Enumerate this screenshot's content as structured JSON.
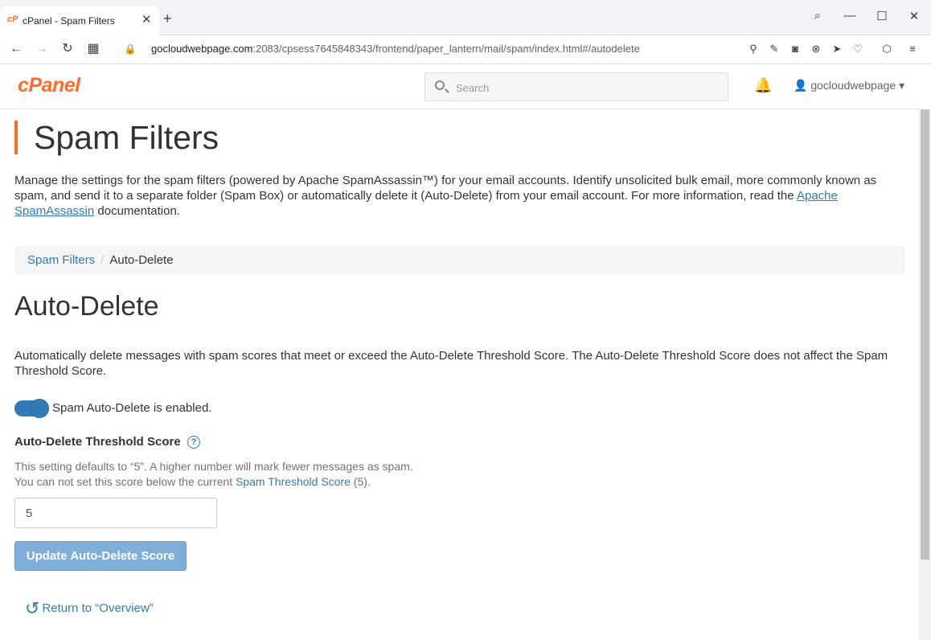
{
  "browser": {
    "tab_favicon": "cP",
    "tab_title": "cPanel - Spam Filters",
    "tab_close": "✕",
    "new_tab": "+",
    "url_host": "gocloudwebpage.com",
    "url_rest": ":2083/cpsess7645848343/frontend/paper_lantern/mail/spam/index.html#/autodelete",
    "window_controls": {
      "search": "⌕",
      "minimize": "—",
      "maximize": "☐",
      "close": "✕"
    },
    "nav": {
      "back": "←",
      "forward": "→",
      "reload": "↻",
      "apps": "▦",
      "lock": "🔒"
    },
    "extension_icons": [
      "zoom-icon",
      "edit-icon",
      "camera-icon",
      "block-icon",
      "send-icon",
      "heart-icon",
      "box-icon",
      "menu-icon"
    ]
  },
  "header": {
    "logo": "cPanel",
    "search_placeholder": "Search",
    "bell": "🔔",
    "user": "👤 gocloudwebpage ▾"
  },
  "page": {
    "title": "Spam Filters",
    "intro_before_link": "Manage the settings for the spam filters (powered by Apache SpamAssassin™) for your email accounts. Identify unsolicited bulk email, more commonly known as spam, and send it to a separate folder (Spam Box) or automatically delete it (Auto-Delete) from your email account. For more information, read the ",
    "intro_link": "Apache SpamAssassin",
    "intro_after_link": " documentation."
  },
  "breadcrumb": {
    "parent": "Spam Filters",
    "separator": "/",
    "current": "Auto-Delete"
  },
  "autodelete": {
    "title": "Auto-Delete",
    "description": "Automatically delete messages with spam scores that meet or exceed the Auto-Delete Threshold Score. The Auto-Delete Threshold Score does not affect the Spam Threshold Score.",
    "toggle_label": "Spam Auto-Delete is enabled.",
    "toggle_enabled": true,
    "field_label": "Auto-Delete Threshold Score",
    "help": "?",
    "hint_line1": "This setting defaults to “5”. A higher number will mark fewer messages as spam.",
    "hint_line2_before": "You can not set this score below the current ",
    "hint_line2_link": "Spam Threshold Score",
    "hint_line2_after": " (5).",
    "score_value": "5",
    "update_button": "Update Auto-Delete Score",
    "return_link": "Return to “Overview”"
  },
  "colors": {
    "brand": "#ff6c2c",
    "link": "#337ab7",
    "button": "#7fafd9"
  }
}
